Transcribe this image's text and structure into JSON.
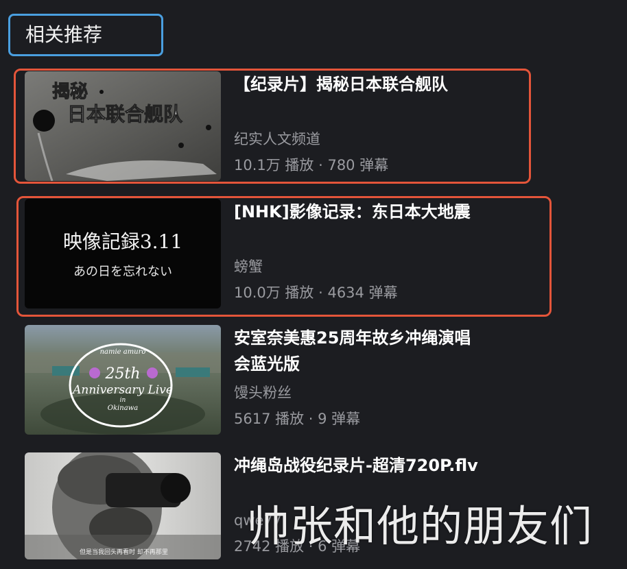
{
  "section": {
    "title": "相关推荐"
  },
  "videos": [
    {
      "title": "【纪录片】揭秘日本联合舰队",
      "uploader": "纪实人文频道",
      "stats": "10.1万 播放 · 780 弹幕",
      "thumb_text": [
        "揭秘",
        "日本联合舰队"
      ]
    },
    {
      "title": "[NHK]影像记录：东日本大地震",
      "uploader": "螃蟹",
      "stats": "10.0万 播放 · 4634 弹幕",
      "thumb_text": [
        "映像記録3.11",
        "あの日を忘れない"
      ]
    },
    {
      "title": "安室奈美惠25周年故乡冲绳演唱会蓝光版",
      "uploader": "馒头粉丝",
      "stats": "5617 播放 · 9 弹幕",
      "thumb_text": [
        "namie amuro",
        "25th",
        "Anniversary Live",
        "in",
        "Okinawa"
      ]
    },
    {
      "title": "冲绳岛战役纪录片-超清720P.flv",
      "uploader": "qwe77",
      "stats": "2742 播放 · 6 弹幕",
      "thumb_text": [
        "但是当我回头再看时 却不再那里"
      ]
    }
  ],
  "watermark": "帅张和他的朋友们",
  "colors": {
    "background": "#1c1d21",
    "highlight_blue": "#4a9fe0",
    "highlight_red": "#e4553a",
    "secondary_text": "#9a9ba0"
  }
}
